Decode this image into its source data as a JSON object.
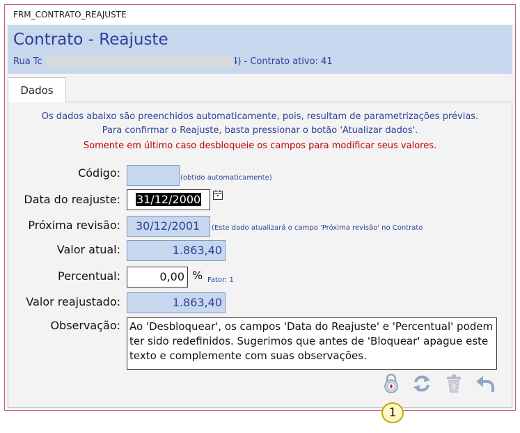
{
  "window": {
    "title": "FRM_CONTRATO_REAJUSTE"
  },
  "header": {
    "title": "Contrato - Reajuste",
    "address_prefix": "Rua Tc",
    "address_suffix": ";4) - Contrato ativo: 41"
  },
  "tabs": [
    {
      "label": "Dados"
    }
  ],
  "info": {
    "line1": "Os dados abaixo são preenchidos automaticamente, pois, resultam de parametrizações prévias.",
    "line2": "Para confirmar o Reajuste, basta pressionar o botão 'Atualizar dados'.",
    "line3": "Somente em último caso desbloqueie os campos para modificar seus valores."
  },
  "fields": {
    "codigo": {
      "label": "Código:",
      "value": "",
      "hint": "(obtido automaticamente)"
    },
    "data_reajuste": {
      "label": "Data do reajuste:",
      "value": "31/12/2000"
    },
    "proxima_revisao": {
      "label": "Próxima revisão:",
      "value": "30/12/2001",
      "hint": "(Este dado atualizará o campo 'Próxima revisão' no Contrato"
    },
    "valor_atual": {
      "label": "Valor atual:",
      "value": "1.863,40"
    },
    "percentual": {
      "label": "Percentual:",
      "value": "0,00",
      "unit": "%",
      "fator": "Fator: 1"
    },
    "valor_reajustado": {
      "label": "Valor reajustado:",
      "value": "1.863,40"
    },
    "observacao": {
      "label": "Observação:",
      "value": "Ao 'Desbloquear', os campos 'Data do Reajuste' e 'Percentual' podem ter sido redefinidos. Sugerimos que antes de 'Bloquear' apague este texto e complemente com suas observações."
    }
  },
  "toolbar": {
    "buttons": [
      {
        "icon": "lock-icon"
      },
      {
        "icon": "refresh-icon"
      },
      {
        "icon": "trash-icon"
      },
      {
        "icon": "undo-icon"
      }
    ]
  },
  "callout": {
    "number": "1"
  },
  "colors": {
    "accent": "#2e3f99",
    "header_bg": "#c6d7ee",
    "warning": "#c00000",
    "border": "#c55a6e"
  }
}
